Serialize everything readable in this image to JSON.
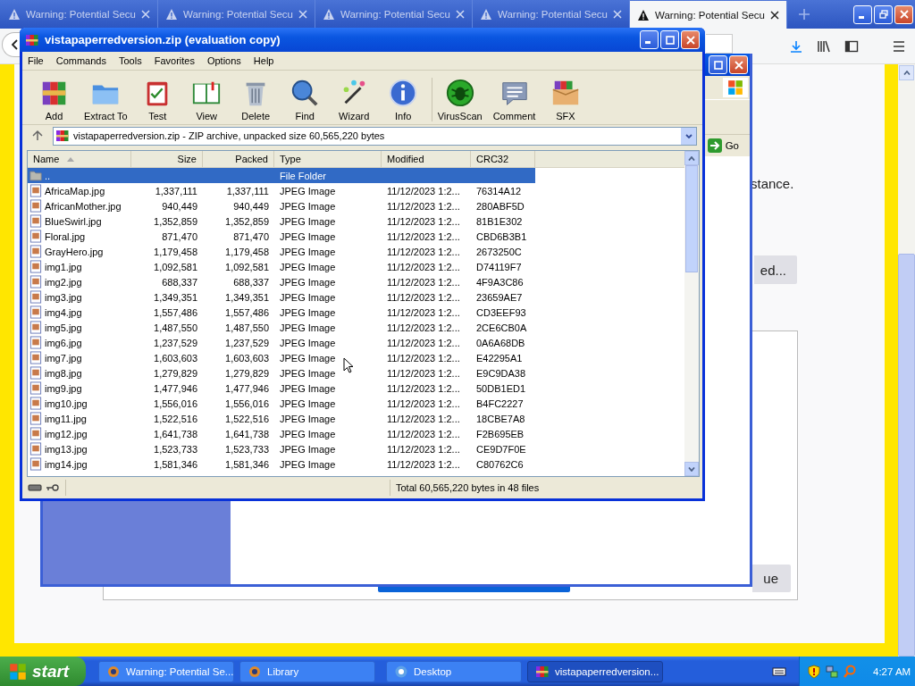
{
  "browser": {
    "tabs": [
      {
        "title": "Warning: Potential Secu",
        "selected": false
      },
      {
        "title": "Warning: Potential Secu",
        "selected": false
      },
      {
        "title": "Warning: Potential Secu",
        "selected": false
      },
      {
        "title": "Warning: Potential Secu",
        "selected": false
      },
      {
        "title": "Warning: Potential Secu",
        "selected": true
      }
    ]
  },
  "page": {
    "text": "stance.",
    "button_1": "ed...",
    "button_2": "ue"
  },
  "back_window": {
    "go_label": "Go"
  },
  "winrar": {
    "title": "vistapaperredversion.zip (evaluation copy)",
    "menu": [
      "File",
      "Commands",
      "Tools",
      "Favorites",
      "Options",
      "Help"
    ],
    "toolbar": [
      "Add",
      "Extract To",
      "Test",
      "View",
      "Delete",
      "Find",
      "Wizard",
      "Info",
      "VirusScan",
      "Comment",
      "SFX"
    ],
    "address": "vistapaperredversion.zip - ZIP archive, unpacked size 60,565,220 bytes",
    "columns": [
      "Name",
      "Size",
      "Packed",
      "Type",
      "Modified",
      "CRC32"
    ],
    "rows": [
      {
        "kind": "folder",
        "name": "..",
        "type": "File Folder",
        "selected": true
      },
      {
        "kind": "file",
        "name": "AfricaMap.jpg",
        "size": "1,337,111",
        "packed": "1,337,111",
        "type": "JPEG Image",
        "modified": "11/12/2023 1:2...",
        "crc": "76314A12",
        "selected": false
      },
      {
        "kind": "file",
        "name": "AfricanMother.jpg",
        "size": "940,449",
        "packed": "940,449",
        "type": "JPEG Image",
        "modified": "11/12/2023 1:2...",
        "crc": "280ABF5D",
        "selected": false
      },
      {
        "kind": "file",
        "name": "BlueSwirl.jpg",
        "size": "1,352,859",
        "packed": "1,352,859",
        "type": "JPEG Image",
        "modified": "11/12/2023 1:2...",
        "crc": "81B1E302",
        "selected": false
      },
      {
        "kind": "file",
        "name": "Floral.jpg",
        "size": "871,470",
        "packed": "871,470",
        "type": "JPEG Image",
        "modified": "11/12/2023 1:2...",
        "crc": "CBD6B3B1",
        "selected": false
      },
      {
        "kind": "file",
        "name": "GrayHero.jpg",
        "size": "1,179,458",
        "packed": "1,179,458",
        "type": "JPEG Image",
        "modified": "11/12/2023 1:2...",
        "crc": "2673250C",
        "selected": false
      },
      {
        "kind": "file",
        "name": "img1.jpg",
        "size": "1,092,581",
        "packed": "1,092,581",
        "type": "JPEG Image",
        "modified": "11/12/2023 1:2...",
        "crc": "D74119F7",
        "selected": false
      },
      {
        "kind": "file",
        "name": "img2.jpg",
        "size": "688,337",
        "packed": "688,337",
        "type": "JPEG Image",
        "modified": "11/12/2023 1:2...",
        "crc": "4F9A3C86",
        "selected": false
      },
      {
        "kind": "file",
        "name": "img3.jpg",
        "size": "1,349,351",
        "packed": "1,349,351",
        "type": "JPEG Image",
        "modified": "11/12/2023 1:2...",
        "crc": "23659AE7",
        "selected": false
      },
      {
        "kind": "file",
        "name": "img4.jpg",
        "size": "1,557,486",
        "packed": "1,557,486",
        "type": "JPEG Image",
        "modified": "11/12/2023 1:2...",
        "crc": "CD3EEF93",
        "selected": false
      },
      {
        "kind": "file",
        "name": "img5.jpg",
        "size": "1,487,550",
        "packed": "1,487,550",
        "type": "JPEG Image",
        "modified": "11/12/2023 1:2...",
        "crc": "2CE6CB0A",
        "selected": false
      },
      {
        "kind": "file",
        "name": "img6.jpg",
        "size": "1,237,529",
        "packed": "1,237,529",
        "type": "JPEG Image",
        "modified": "11/12/2023 1:2...",
        "crc": "0A6A68DB",
        "selected": false
      },
      {
        "kind": "file",
        "name": "img7.jpg",
        "size": "1,603,603",
        "packed": "1,603,603",
        "type": "JPEG Image",
        "modified": "11/12/2023 1:2...",
        "crc": "E42295A1",
        "selected": false
      },
      {
        "kind": "file",
        "name": "img8.jpg",
        "size": "1,279,829",
        "packed": "1,279,829",
        "type": "JPEG Image",
        "modified": "11/12/2023 1:2...",
        "crc": "E9C9DA38",
        "selected": false
      },
      {
        "kind": "file",
        "name": "img9.jpg",
        "size": "1,477,946",
        "packed": "1,477,946",
        "type": "JPEG Image",
        "modified": "11/12/2023 1:2...",
        "crc": "50DB1ED1",
        "selected": false
      },
      {
        "kind": "file",
        "name": "img10.jpg",
        "size": "1,556,016",
        "packed": "1,556,016",
        "type": "JPEG Image",
        "modified": "11/12/2023 1:2...",
        "crc": "B4FC2227",
        "selected": false
      },
      {
        "kind": "file",
        "name": "img11.jpg",
        "size": "1,522,516",
        "packed": "1,522,516",
        "type": "JPEG Image",
        "modified": "11/12/2023 1:2...",
        "crc": "18CBE7A8",
        "selected": false
      },
      {
        "kind": "file",
        "name": "img12.jpg",
        "size": "1,641,738",
        "packed": "1,641,738",
        "type": "JPEG Image",
        "modified": "11/12/2023 1:2...",
        "crc": "F2B695EB",
        "selected": false
      },
      {
        "kind": "file",
        "name": "img13.jpg",
        "size": "1,523,733",
        "packed": "1,523,733",
        "type": "JPEG Image",
        "modified": "11/12/2023 1:2...",
        "crc": "CE9D7F0E",
        "selected": false
      },
      {
        "kind": "file",
        "name": "img14.jpg",
        "size": "1,581,346",
        "packed": "1,581,346",
        "type": "JPEG Image",
        "modified": "11/12/2023 1:2...",
        "crc": "C80762C6",
        "selected": false
      }
    ],
    "status": "Total 60,565,220 bytes in 48 files"
  },
  "taskbar": {
    "start": "start",
    "buttons": [
      {
        "label": "Warning: Potential Se...",
        "selected": false
      },
      {
        "label": "Library",
        "selected": false
      },
      {
        "label": "Desktop",
        "selected": false
      },
      {
        "label": "vistapaperredversion...",
        "selected": true
      }
    ],
    "clock": "4:27 AM"
  }
}
